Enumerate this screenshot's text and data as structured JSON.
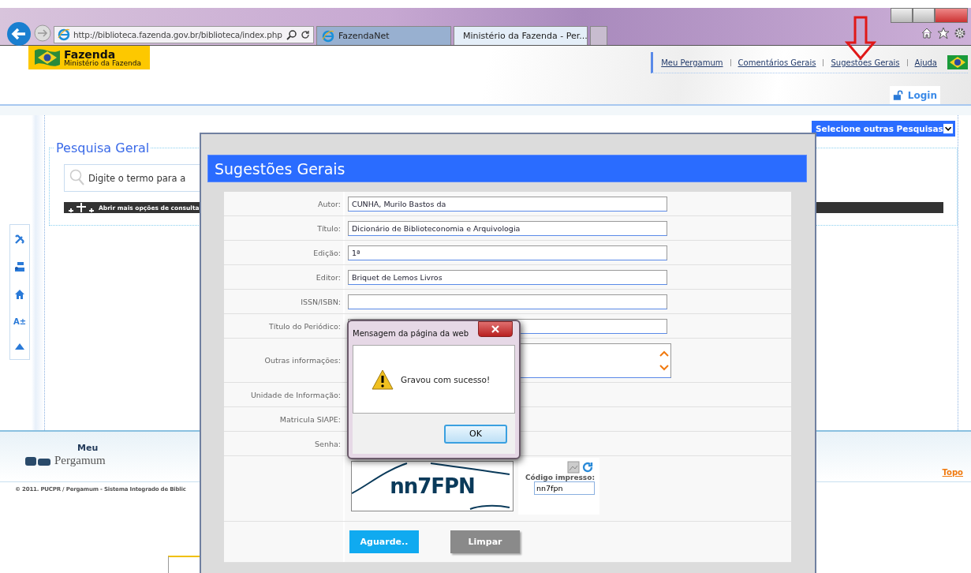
{
  "browser": {
    "address": "http://biblioteca.fazenda.gov.br/biblioteca/index.php",
    "tabs": [
      {
        "label": "FazendaNet",
        "selected": false
      },
      {
        "label": "Ministério da Fazenda - Per...",
        "selected": true
      }
    ]
  },
  "header": {
    "logo_title": "Fazenda",
    "logo_subtitle": "Ministério da Fazenda",
    "nav": [
      "Meu Pergamum",
      "Comentários Gerais",
      "Sugestões Gerais",
      "Ajuda"
    ],
    "login": "Login"
  },
  "sidebar": [
    {
      "kind": "tools"
    },
    {
      "kind": "pergamum"
    },
    {
      "kind": "home"
    },
    {
      "kind": "text",
      "label": "A±"
    },
    {
      "kind": "up"
    }
  ],
  "search": {
    "legend": "Pesquisa Geral",
    "placeholder": "Digite o termo para a",
    "more_options": "Abrir mais opções de consulta",
    "other_searches": "Selecione outras Pesquisas"
  },
  "footer": {
    "logo_meu": "Meu",
    "logo_name": "Pergamum",
    "top_link": "Topo",
    "copyright": "© 2011. PUCPR / Pergamum - Sistema Integrado de Biblic"
  },
  "modal": {
    "title": "Sugestões Gerais",
    "fields": [
      {
        "label": "Autor:",
        "kind": "text",
        "value": "CUNHA, Murilo Bastos da"
      },
      {
        "label": "Título:",
        "kind": "text",
        "value": "Dicionário de Biblioteconomia e Arquivologia"
      },
      {
        "label": "Edição:",
        "kind": "text",
        "value": "1ª"
      },
      {
        "label": "Editor:",
        "kind": "text",
        "value": "Briquet de Lemos Livros"
      },
      {
        "label": "ISSN/ISBN:",
        "kind": "text"
      },
      {
        "label": "Título do Periódico:",
        "kind": "text"
      },
      {
        "label": "Outras informações:",
        "kind": "textarea"
      },
      {
        "label": "Unidade de Informação:",
        "kind": "blank"
      },
      {
        "label": "Matricula SIAPE:",
        "kind": "blank"
      },
      {
        "label": "Senha:",
        "kind": "blank"
      }
    ],
    "captcha": {
      "text": "nn7FPN",
      "code_label": "Código impresso:",
      "code_value": "nn7fpn"
    },
    "buttons": [
      {
        "label": "Aguarde..",
        "kind": "primary"
      },
      {
        "label": "Limpar",
        "kind": "secondary"
      }
    ]
  },
  "alert": {
    "title": "Mensagem da página da web",
    "message": "Gravou com sucesso!",
    "button": "OK"
  }
}
